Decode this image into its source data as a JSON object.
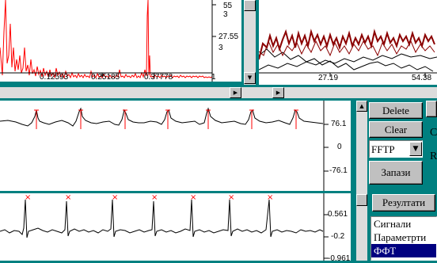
{
  "top_left_panel": {
    "y_ticks": [
      "55",
      "3",
      "27.55",
      "3"
    ],
    "x_ticks": [
      "0.12593",
      "0.25185",
      "0.37778",
      "1"
    ]
  },
  "top_right_panel": {
    "x_ticks": [
      "27.19",
      "54.38"
    ]
  },
  "ecg_panel": {
    "y_ticks": [
      "76.1",
      "0",
      "-76.1"
    ]
  },
  "rr_panel": {
    "y_ticks": [
      "0.561",
      "-0.2",
      "-0.961"
    ]
  },
  "controls": {
    "delete_label": "Delete",
    "clear_label": "Clear",
    "select_value": "FFTP",
    "save_label": "Запази",
    "results_tab_label": "Резултати",
    "partial_label_c": "C",
    "partial_label_r": "R"
  },
  "results_list": {
    "items": [
      "Сигнали",
      "Параметрти",
      "ФФТ"
    ],
    "selected_index": 2
  },
  "colors": {
    "background": "#008080",
    "spectrum": "#ff0000",
    "trace_red": "#8b0000",
    "trace_black": "#000000",
    "selection": "#000080"
  }
}
